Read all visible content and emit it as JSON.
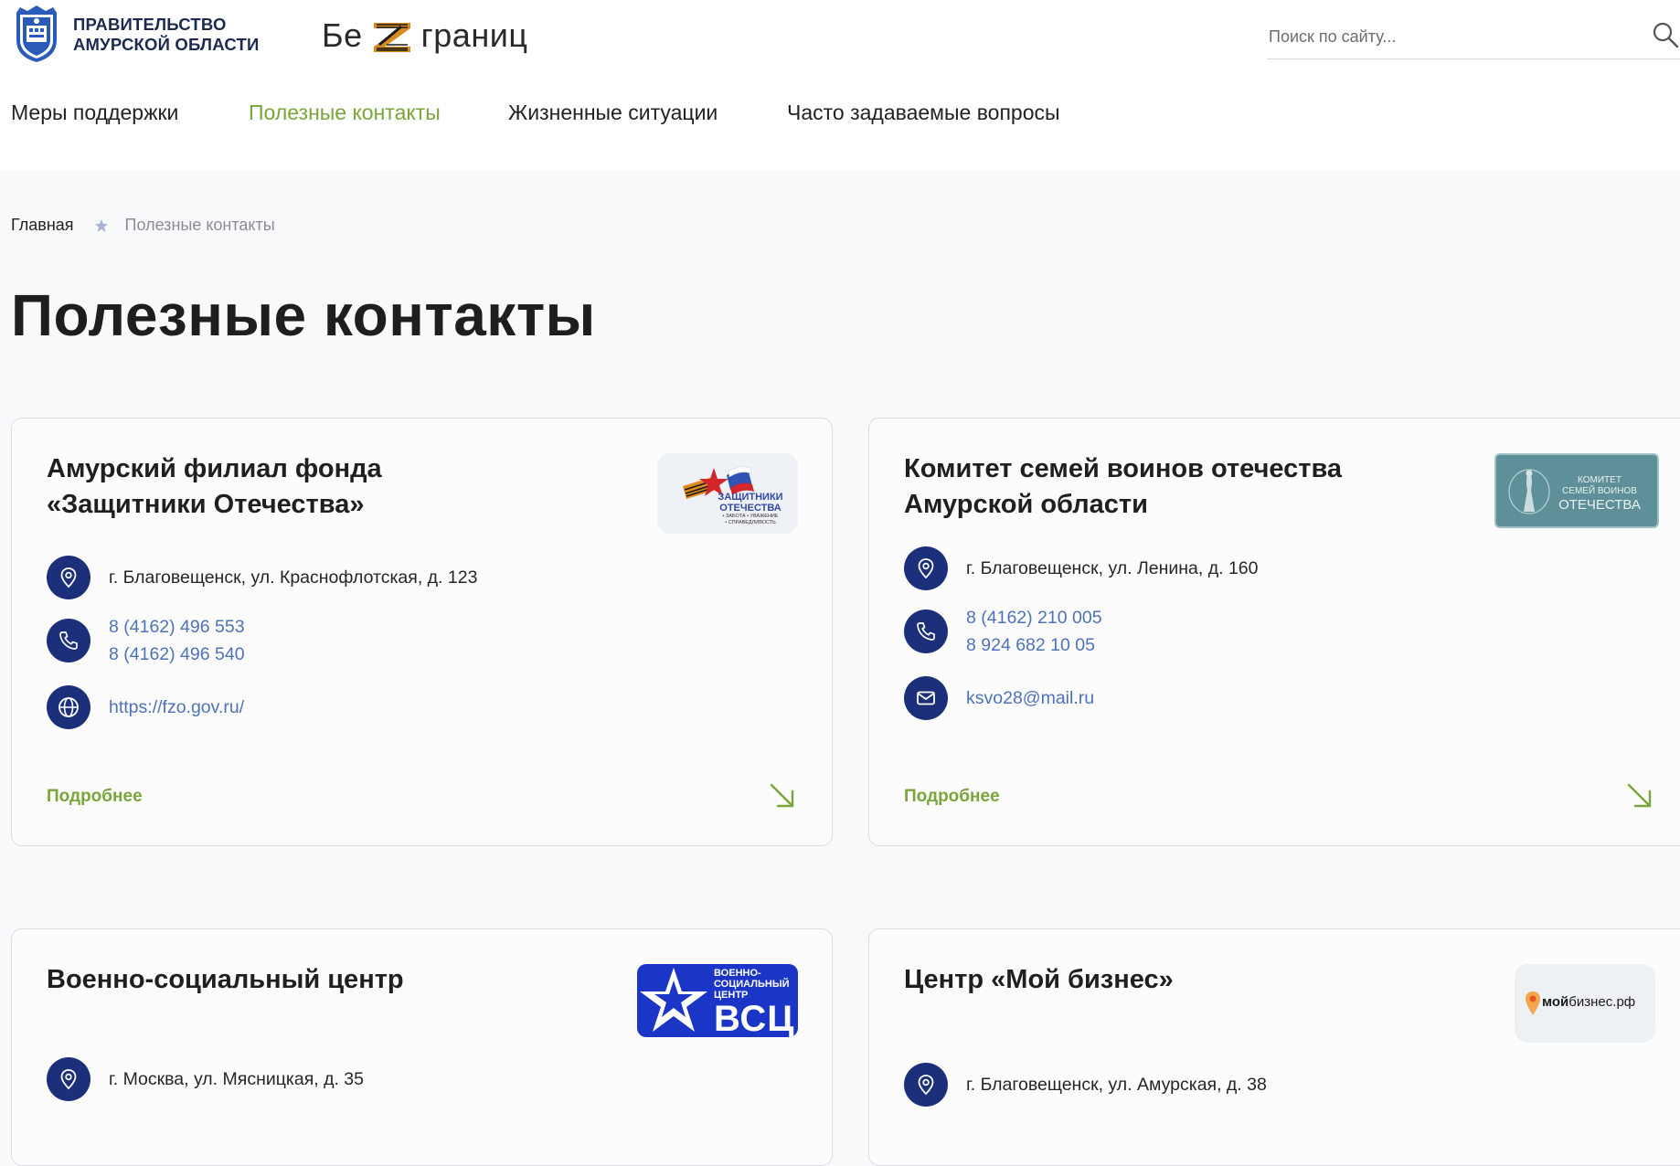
{
  "header": {
    "gov_title_line1": "ПРАВИТЕЛЬСТВО",
    "gov_title_line2": "АМУРСКОЙ ОБЛАСТИ",
    "brand_left": "Бе",
    "brand_right": "границ",
    "search_placeholder": "Поиск по сайту..."
  },
  "nav": {
    "items": [
      {
        "label": "Меры поддержки"
      },
      {
        "label": "Полезные контакты",
        "active": true
      },
      {
        "label": "Жизненные ситуации"
      },
      {
        "label": "Часто задаваемые вопросы"
      }
    ]
  },
  "breadcrumb": {
    "home": "Главная",
    "current": "Полезные контакты"
  },
  "page_title": "Полезные контакты",
  "more_label": "Подробнее",
  "cards": [
    {
      "title_line1": "Амурский филиал фонда",
      "title_line2": "«Защитники Отечества»",
      "address": "г. Благовещенск, ул. Краснофлотская, д. 123",
      "phones": [
        "8 (4162) 496 553",
        "8 (4162) 496 540"
      ],
      "website": "https://fzo.gov.ru/",
      "logo_text1": "ЗАЩИТНИКИ",
      "logo_text2": "ОТЕЧЕСТВА",
      "logo_text3": "• ЗАБОТА • УВАЖЕНИЕ",
      "logo_text4": "• СПРАВЕДЛИВОСТЬ"
    },
    {
      "title_line1": "Комитет семей воинов отечества",
      "title_line2": "Амурской области",
      "address": "г. Благовещенск, ул. Ленина, д. 160",
      "phones": [
        "8 (4162) 210 005",
        "8 924 682 10 05"
      ],
      "email": "ksvo28@mail.ru",
      "logo_text1": "КОМИТЕТ",
      "logo_text2": "СЕМЕЙ ВОИНОВ",
      "logo_text3": "ОТЕЧЕСТВА"
    },
    {
      "title_line1": "Военно-социальный центр",
      "address": "г. Москва, ул. Мясницкая, д. 35",
      "logo_text1": "ВОЕННО-",
      "logo_text2": "СОЦИАЛЬНЫЙ",
      "logo_text3": "ЦЕНТР",
      "logo_text4": "ВСЦ"
    },
    {
      "title_line1": "Центр «Мой бизнес»",
      "address": "г. Благовещенск, ул. Амурская, д. 38",
      "logo_text1": "мой",
      "logo_text2": "бизнес.рф"
    }
  ],
  "colors": {
    "accent_green": "#79a53a",
    "icon_navy": "#1c2f7a",
    "link_blue": "#4d72b8"
  }
}
